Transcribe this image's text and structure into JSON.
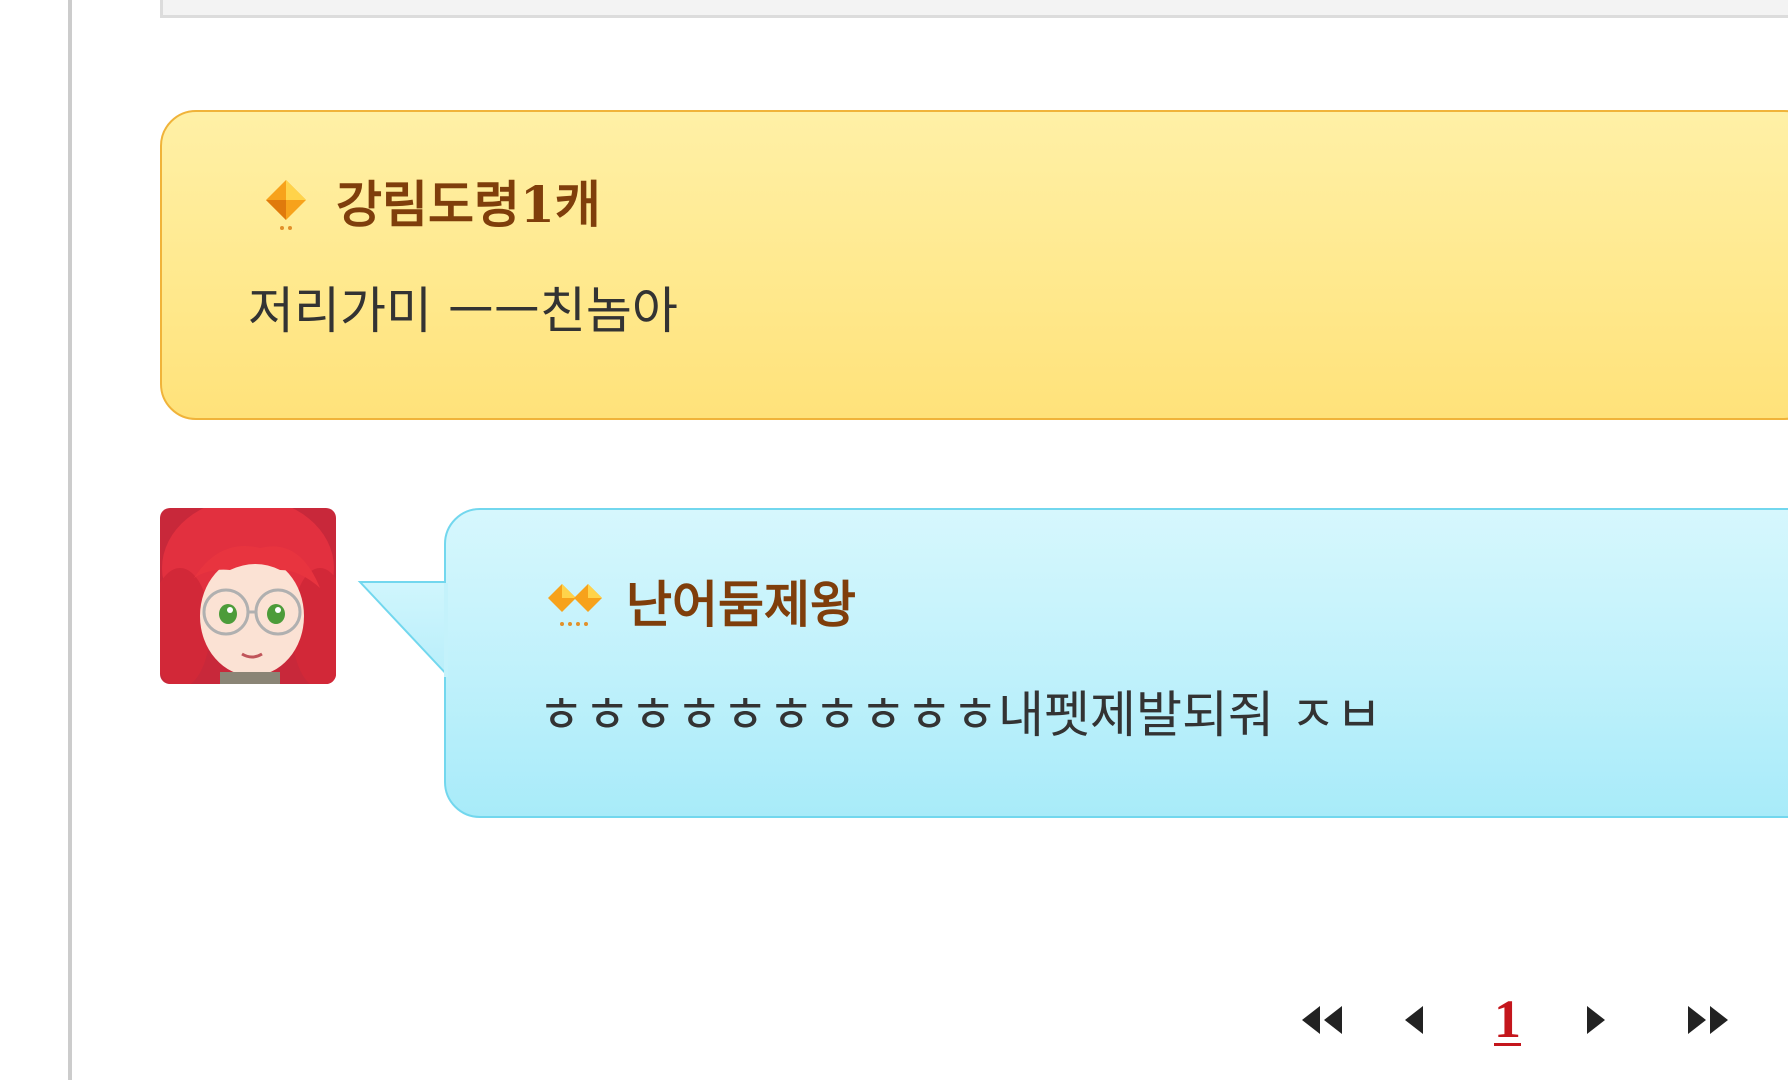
{
  "comments": [
    {
      "username": "강림도령1캐",
      "message": "저리가미 ㅡㅡ친놈아",
      "badge_icon": "diamond-badge-icon",
      "bubble_color": "#ffe98e"
    },
    {
      "username": "난어둠제왕",
      "message": "ㅎㅎㅎㅎㅎㅎㅎㅎㅎㅎ내펫제발되줘 ㅈㅂ",
      "badge_icon": "double-diamond-badge-icon",
      "avatar_icon": "red-haired-glasses-girl-avatar",
      "bubble_color": "#bff1fb"
    }
  ],
  "pagination": {
    "first_icon": "double-left-arrow-icon",
    "prev_icon": "left-arrow-icon",
    "current_page": "1",
    "next_icon": "right-arrow-icon",
    "last_icon": "double-right-arrow-icon",
    "current_color": "#c4161c"
  }
}
